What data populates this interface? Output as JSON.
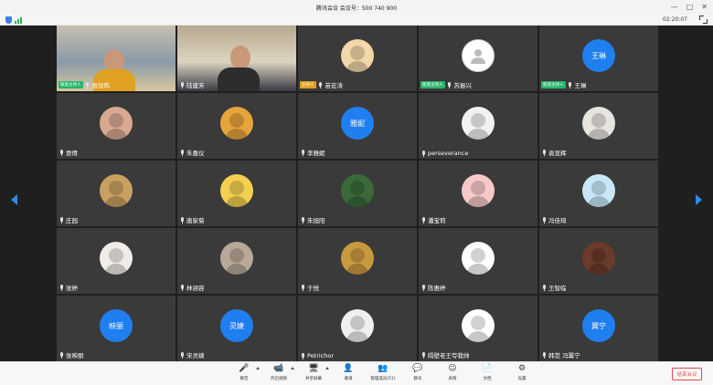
{
  "window": {
    "title": "腾讯会议  会议号：500 740 900",
    "controls": [
      "—",
      "□",
      "✕"
    ]
  },
  "status": {
    "timer": "02:20:07"
  },
  "host_badge": "联席主持人",
  "host_badge_main": "主持人",
  "participants": [
    {
      "name": "张剑鸣",
      "badge": "联席主持人",
      "type": "photo",
      "palette": [
        "#c8c0b0",
        "#8a9aa8",
        "#d8c8a0"
      ]
    },
    {
      "name": "陆建芳",
      "badge": "",
      "type": "photo",
      "palette": [
        "#b8a890",
        "#dcd4c0",
        "#3a3a46"
      ]
    },
    {
      "name": "苗宏涛",
      "badge": "主持人",
      "type": "avatar",
      "avatar_color": "#f3d7a8",
      "icon": "cartoon-dog-avatar"
    },
    {
      "name": "苏振兴",
      "badge": "联席主持人",
      "type": "avatar",
      "avatar_color": "#ffffff",
      "icon": "default-user-avatar"
    },
    {
      "name": "王琳",
      "badge": "联席主持人",
      "type": "text-avatar",
      "avatar_text": "王琳"
    },
    {
      "name": "贾倩",
      "badge": "",
      "type": "avatar",
      "avatar_color": "#d8a890",
      "icon": "girl-avatar"
    },
    {
      "name": "朱嘉仪",
      "badge": "",
      "type": "avatar",
      "avatar_color": "#e6a43a",
      "icon": "sunflower-avatar"
    },
    {
      "name": "李雅妮",
      "badge": "",
      "type": "text-avatar",
      "avatar_text": "雅妮"
    },
    {
      "name": "perseverance",
      "badge": "",
      "type": "avatar",
      "avatar_color": "#f2f2f2",
      "icon": "anime-boy-avatar"
    },
    {
      "name": "袁显辉",
      "badge": "",
      "type": "avatar",
      "avatar_color": "#e8e4e0",
      "icon": "anime-character-avatar"
    },
    {
      "name": "庄园",
      "badge": "",
      "type": "avatar",
      "avatar_color": "#c8a060",
      "icon": "painting-avatar"
    },
    {
      "name": "唐家菊",
      "badge": "",
      "type": "avatar",
      "avatar_color": "#f3d050",
      "icon": "child-avatar"
    },
    {
      "name": "朱旭阳",
      "badge": "",
      "type": "avatar",
      "avatar_color": "#3a6a3a",
      "icon": "basketball-player-avatar"
    },
    {
      "name": "潘宝莉",
      "badge": "",
      "type": "avatar",
      "avatar_color": "#f7c8c8",
      "icon": "pink-rabbit-avatar"
    },
    {
      "name": "冯佳琦",
      "badge": "",
      "type": "avatar",
      "avatar_color": "#c8e8f8",
      "icon": "bunny-avatar"
    },
    {
      "name": "张婷",
      "badge": "",
      "type": "avatar",
      "avatar_color": "#f0ece8",
      "icon": "sketch-girl-avatar"
    },
    {
      "name": "林涵容",
      "badge": "",
      "type": "avatar",
      "avatar_color": "#b8a898",
      "icon": "photo-avatar"
    },
    {
      "name": "于悦",
      "badge": "",
      "type": "avatar",
      "avatar_color": "#c89a40",
      "icon": "sloth-avatar"
    },
    {
      "name": "陈惠婷",
      "badge": "",
      "type": "avatar",
      "avatar_color": "#ffffff",
      "icon": "reading-rabbit-avatar"
    },
    {
      "name": "王智临",
      "badge": "",
      "type": "avatar",
      "avatar_color": "#6a3a2a",
      "icon": "dark-portrait-avatar"
    },
    {
      "name": "张映丽",
      "badge": "",
      "type": "text-avatar",
      "avatar_text": "映丽"
    },
    {
      "name": "宋灵婕",
      "badge": "",
      "type": "text-avatar",
      "avatar_text": "灵婕"
    },
    {
      "name": "Petrichor",
      "badge": "",
      "type": "avatar",
      "avatar_color": "#f0f0f0",
      "icon": "kid-avatar"
    },
    {
      "name": "隔壁老王夸我帅",
      "badge": "",
      "type": "avatar",
      "avatar_color": "#ffffff",
      "icon": "doodle-girl-avatar"
    },
    {
      "name": "韩范 冯翼宁",
      "badge": "",
      "type": "text-avatar",
      "avatar_text": "翼宁"
    }
  ],
  "toolbar": {
    "items": [
      {
        "label": "静音",
        "icon": "microphone-icon",
        "glyph": "🎤",
        "caret": true
      },
      {
        "label": "开启视频",
        "icon": "video-camera-icon",
        "glyph": "📹",
        "caret": true
      },
      {
        "label": "共享屏幕",
        "icon": "share-screen-icon",
        "glyph": "🖥",
        "caret": true
      },
      {
        "label": "邀请",
        "icon": "invite-icon",
        "glyph": "👤",
        "caret": false
      },
      {
        "label": "管理成员(51)",
        "icon": "members-icon",
        "glyph": "👥",
        "caret": false
      },
      {
        "label": "聊天",
        "icon": "chat-icon",
        "glyph": "💬",
        "caret": false
      },
      {
        "label": "表情",
        "icon": "emoji-icon",
        "glyph": "☺",
        "caret": false
      },
      {
        "label": "文档",
        "icon": "document-icon",
        "glyph": "📄",
        "caret": false
      },
      {
        "label": "设置",
        "icon": "settings-icon",
        "glyph": "⚙",
        "caret": false
      }
    ],
    "leave_label": "结束会议"
  }
}
